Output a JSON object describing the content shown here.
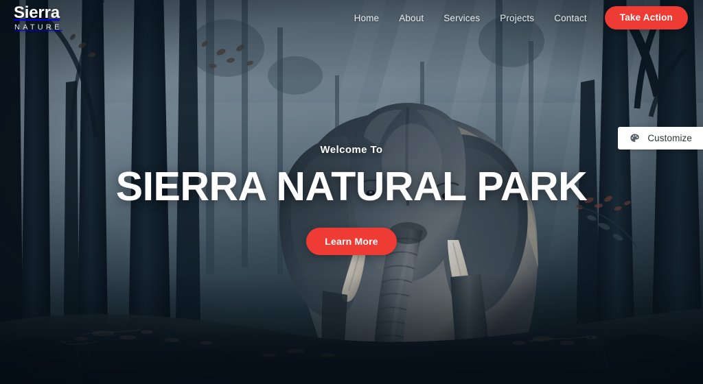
{
  "brand": {
    "name": "Sierra",
    "tagline": "NATURE"
  },
  "nav": {
    "items": [
      {
        "label": "Home"
      },
      {
        "label": "About"
      },
      {
        "label": "Services"
      },
      {
        "label": "Projects"
      },
      {
        "label": "Contact"
      }
    ],
    "cta_label": "Take Action"
  },
  "hero": {
    "eyebrow": "Welcome To",
    "title": "SIERRA NATURAL PARK",
    "button_label": "Learn More"
  },
  "customize": {
    "label": "Customize",
    "icon": "palette-icon"
  },
  "colors": {
    "accent_red": "#ee3b33",
    "text_light": "#ffffff",
    "nav_text": "#e8ecef",
    "panel_bg": "#ffffff",
    "panel_text": "#2c3338",
    "scene_dark": "#16242f",
    "scene_mist": "#8d9ba6"
  },
  "background": {
    "description": "Dark misty forest at dawn with sun rays and an elephant walking toward the viewer"
  }
}
